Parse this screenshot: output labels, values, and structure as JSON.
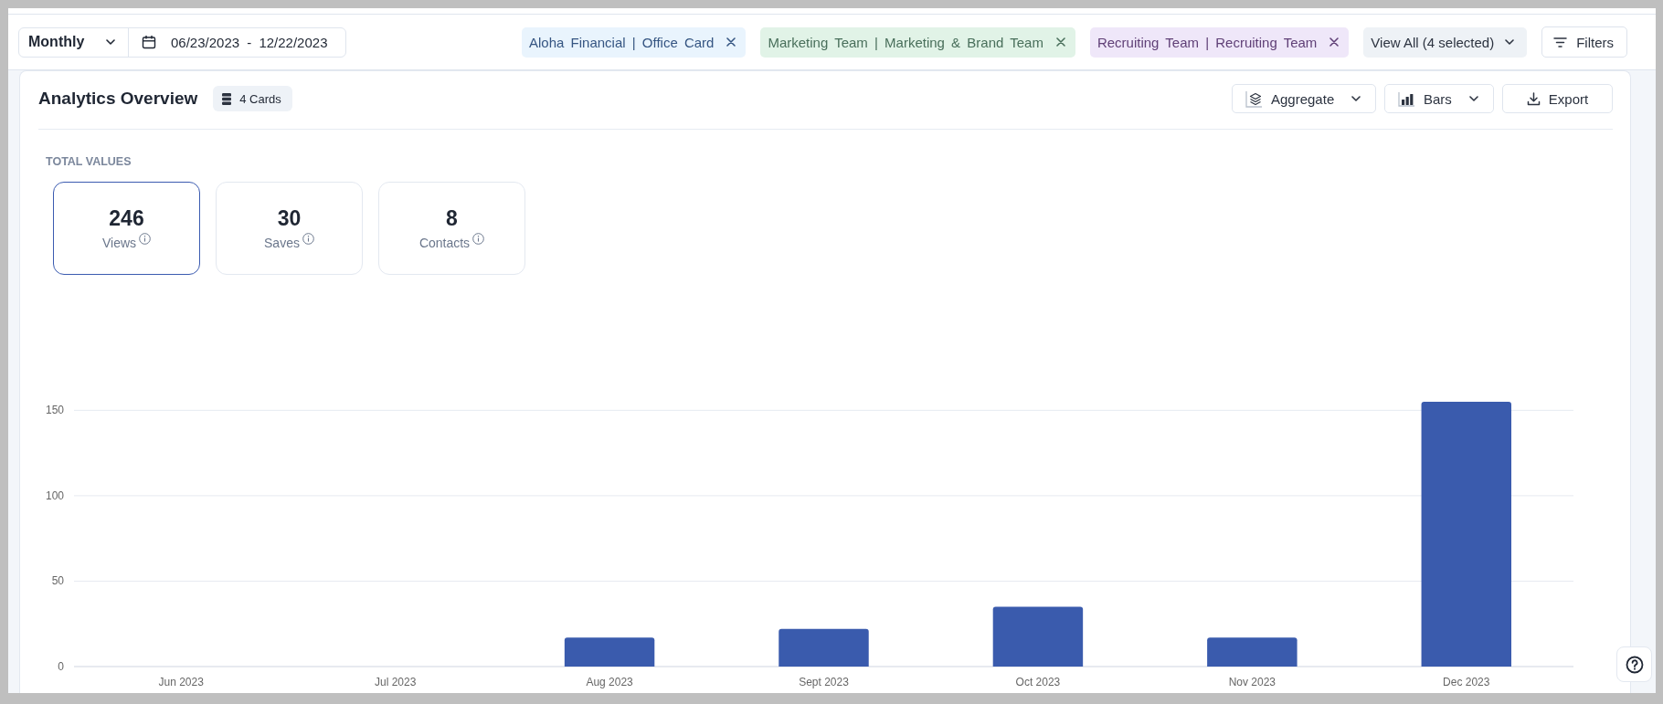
{
  "toolbar": {
    "period": {
      "label": "Monthly"
    },
    "date_range": {
      "value": "06/23/2023 - 12/22/2023"
    },
    "filter_chips": [
      {
        "label": "Aloha Financial | Office Card",
        "color": "#e9f4fd"
      },
      {
        "label": "Marketing Team | Marketing & Brand Team",
        "color": "#e1f3e7"
      },
      {
        "label": "Recruiting Team | Recruiting Team",
        "color": "#efe7f9"
      }
    ],
    "view_all": {
      "label": "View All (4 selected)"
    },
    "filters_button": {
      "label": "Filters"
    }
  },
  "panel": {
    "title": "Analytics Overview",
    "cards_badge": "4 Cards",
    "aggregate_menu": {
      "label": "Aggregate"
    },
    "chart_type_menu": {
      "label": "Bars"
    },
    "export_button": {
      "label": "Export"
    },
    "section_label": "TOTAL VALUES",
    "metrics": [
      {
        "value": "246",
        "label": "Views",
        "selected": true
      },
      {
        "value": "30",
        "label": "Saves",
        "selected": false
      },
      {
        "value": "8",
        "label": "Contacts",
        "selected": false
      }
    ],
    "chart": {
      "chart_data": {
        "type": "bar",
        "categories": [
          "Jun 2023",
          "Jul 2023",
          "Aug 2023",
          "Sept 2023",
          "Oct 2023",
          "Nov 2023",
          "Dec 2023"
        ],
        "series": [
          {
            "color": "#3a5bad",
            "values": [
              0,
              0,
              17,
              22,
              35,
              17,
              155
            ]
          }
        ],
        "ylim": [
          0,
          155
        ],
        "yticks": [
          0,
          50,
          100,
          150
        ],
        "grid": true
      }
    }
  }
}
